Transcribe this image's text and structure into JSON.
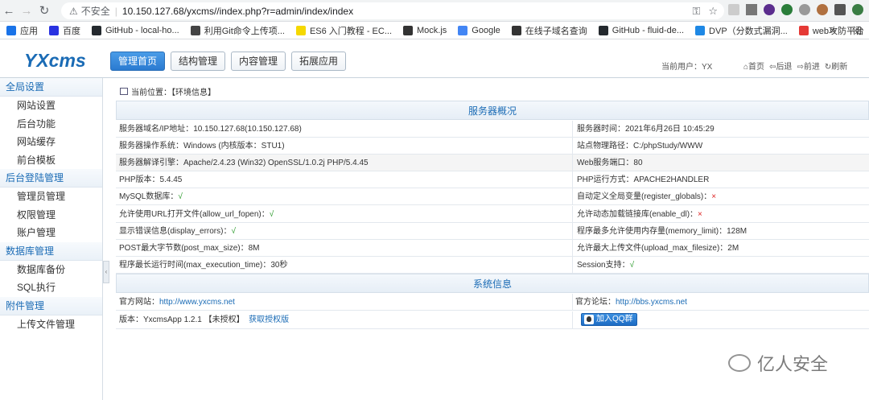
{
  "browser": {
    "insecure_label": "不安全",
    "url": "10.150.127.68/yxcms//index.php?r=admin/index/index",
    "bookmarks": [
      {
        "label": "应用",
        "color": "#1a73e8"
      },
      {
        "label": "百度",
        "color": "#2932e1"
      },
      {
        "label": "GitHub - local-ho...",
        "color": "#24292e"
      },
      {
        "label": "利用Git命令上传项...",
        "color": "#444"
      },
      {
        "label": "ES6 入门教程 - EC...",
        "color": "#f5d800"
      },
      {
        "label": "Mock.js",
        "color": "#333"
      },
      {
        "label": "Google",
        "color": "#4285f4"
      },
      {
        "label": "在线子域名查询",
        "color": "#333"
      },
      {
        "label": "GitHub - fluid-de...",
        "color": "#24292e"
      },
      {
        "label": "DVP（分数式漏洞...",
        "color": "#1e88e5"
      },
      {
        "label": "web攻防平台",
        "color": "#e53935"
      }
    ],
    "more_label": "»",
    "reading_list_label": "阅"
  },
  "header": {
    "logo": "YXcms",
    "tabs": [
      {
        "label": "管理首页",
        "active": true
      },
      {
        "label": "结构管理",
        "active": false
      },
      {
        "label": "内容管理",
        "active": false
      },
      {
        "label": "拓展应用",
        "active": false
      }
    ],
    "current_user": "当前用户：YX",
    "links": [
      "首页",
      "后退",
      "前进",
      "刷新"
    ]
  },
  "sidebar": {
    "groups": [
      {
        "title": "全局设置",
        "items": [
          "网站设置",
          "后台功能",
          "网站缓存",
          "前台模板"
        ]
      },
      {
        "title": "后台登陆管理",
        "items": [
          "管理员管理",
          "权限管理",
          "账户管理"
        ]
      },
      {
        "title": "数据库管理",
        "items": [
          "数据库备份",
          "SQL执行"
        ]
      },
      {
        "title": "附件管理",
        "items": [
          "上传文件管理"
        ]
      }
    ]
  },
  "breadcrumb": "当前位置：【环境信息】",
  "server": {
    "title": "服务器概况",
    "rows": [
      [
        "服务器域名/IP地址：10.150.127.68(10.150.127.68)",
        "服务器时间：2021年6月26日 10:45:29"
      ],
      [
        "服务器操作系统：Windows (内核版本：STU1)",
        "站点物理路径：C:/phpStudy/WWW"
      ],
      [
        "服务器解译引擎：Apache/2.4.23 (Win32) OpenSSL/1.0.2j PHP/5.4.45",
        "Web服务端口：80"
      ],
      [
        "PHP版本：5.4.45",
        "PHP运行方式：APACHE2HANDLER"
      ],
      [
        "MySQL数据库：",
        "自动定义全局变量(register_globals)："
      ],
      [
        "允许使用URL打开文件(allow_url_fopen)：",
        "允许动态加载链接库(enable_dl)："
      ],
      [
        "显示错误信息(display_errors)：",
        "程序最多允许使用内存量(memory_limit)：128M"
      ],
      [
        "POST最大字节数(post_max_size)：8M",
        "允许最大上传文件(upload_max_filesize)：2M"
      ],
      [
        "程序最长运行时间(max_execution_time)：30秒",
        "Session支持："
      ]
    ],
    "check_mark": "√",
    "cross_mark": "×"
  },
  "system": {
    "title": "系统信息",
    "official_site_label": "官方网站：",
    "official_site": "http://www.yxcms.net",
    "forum_label": "官方论坛：",
    "forum": "http://bbs.yxcms.net",
    "version": "版本：YxcmsApp 1.2.1 【未授权】",
    "get_license": "获取授权版",
    "qq_group": "加入QQ群"
  },
  "watermark": "亿人安全"
}
